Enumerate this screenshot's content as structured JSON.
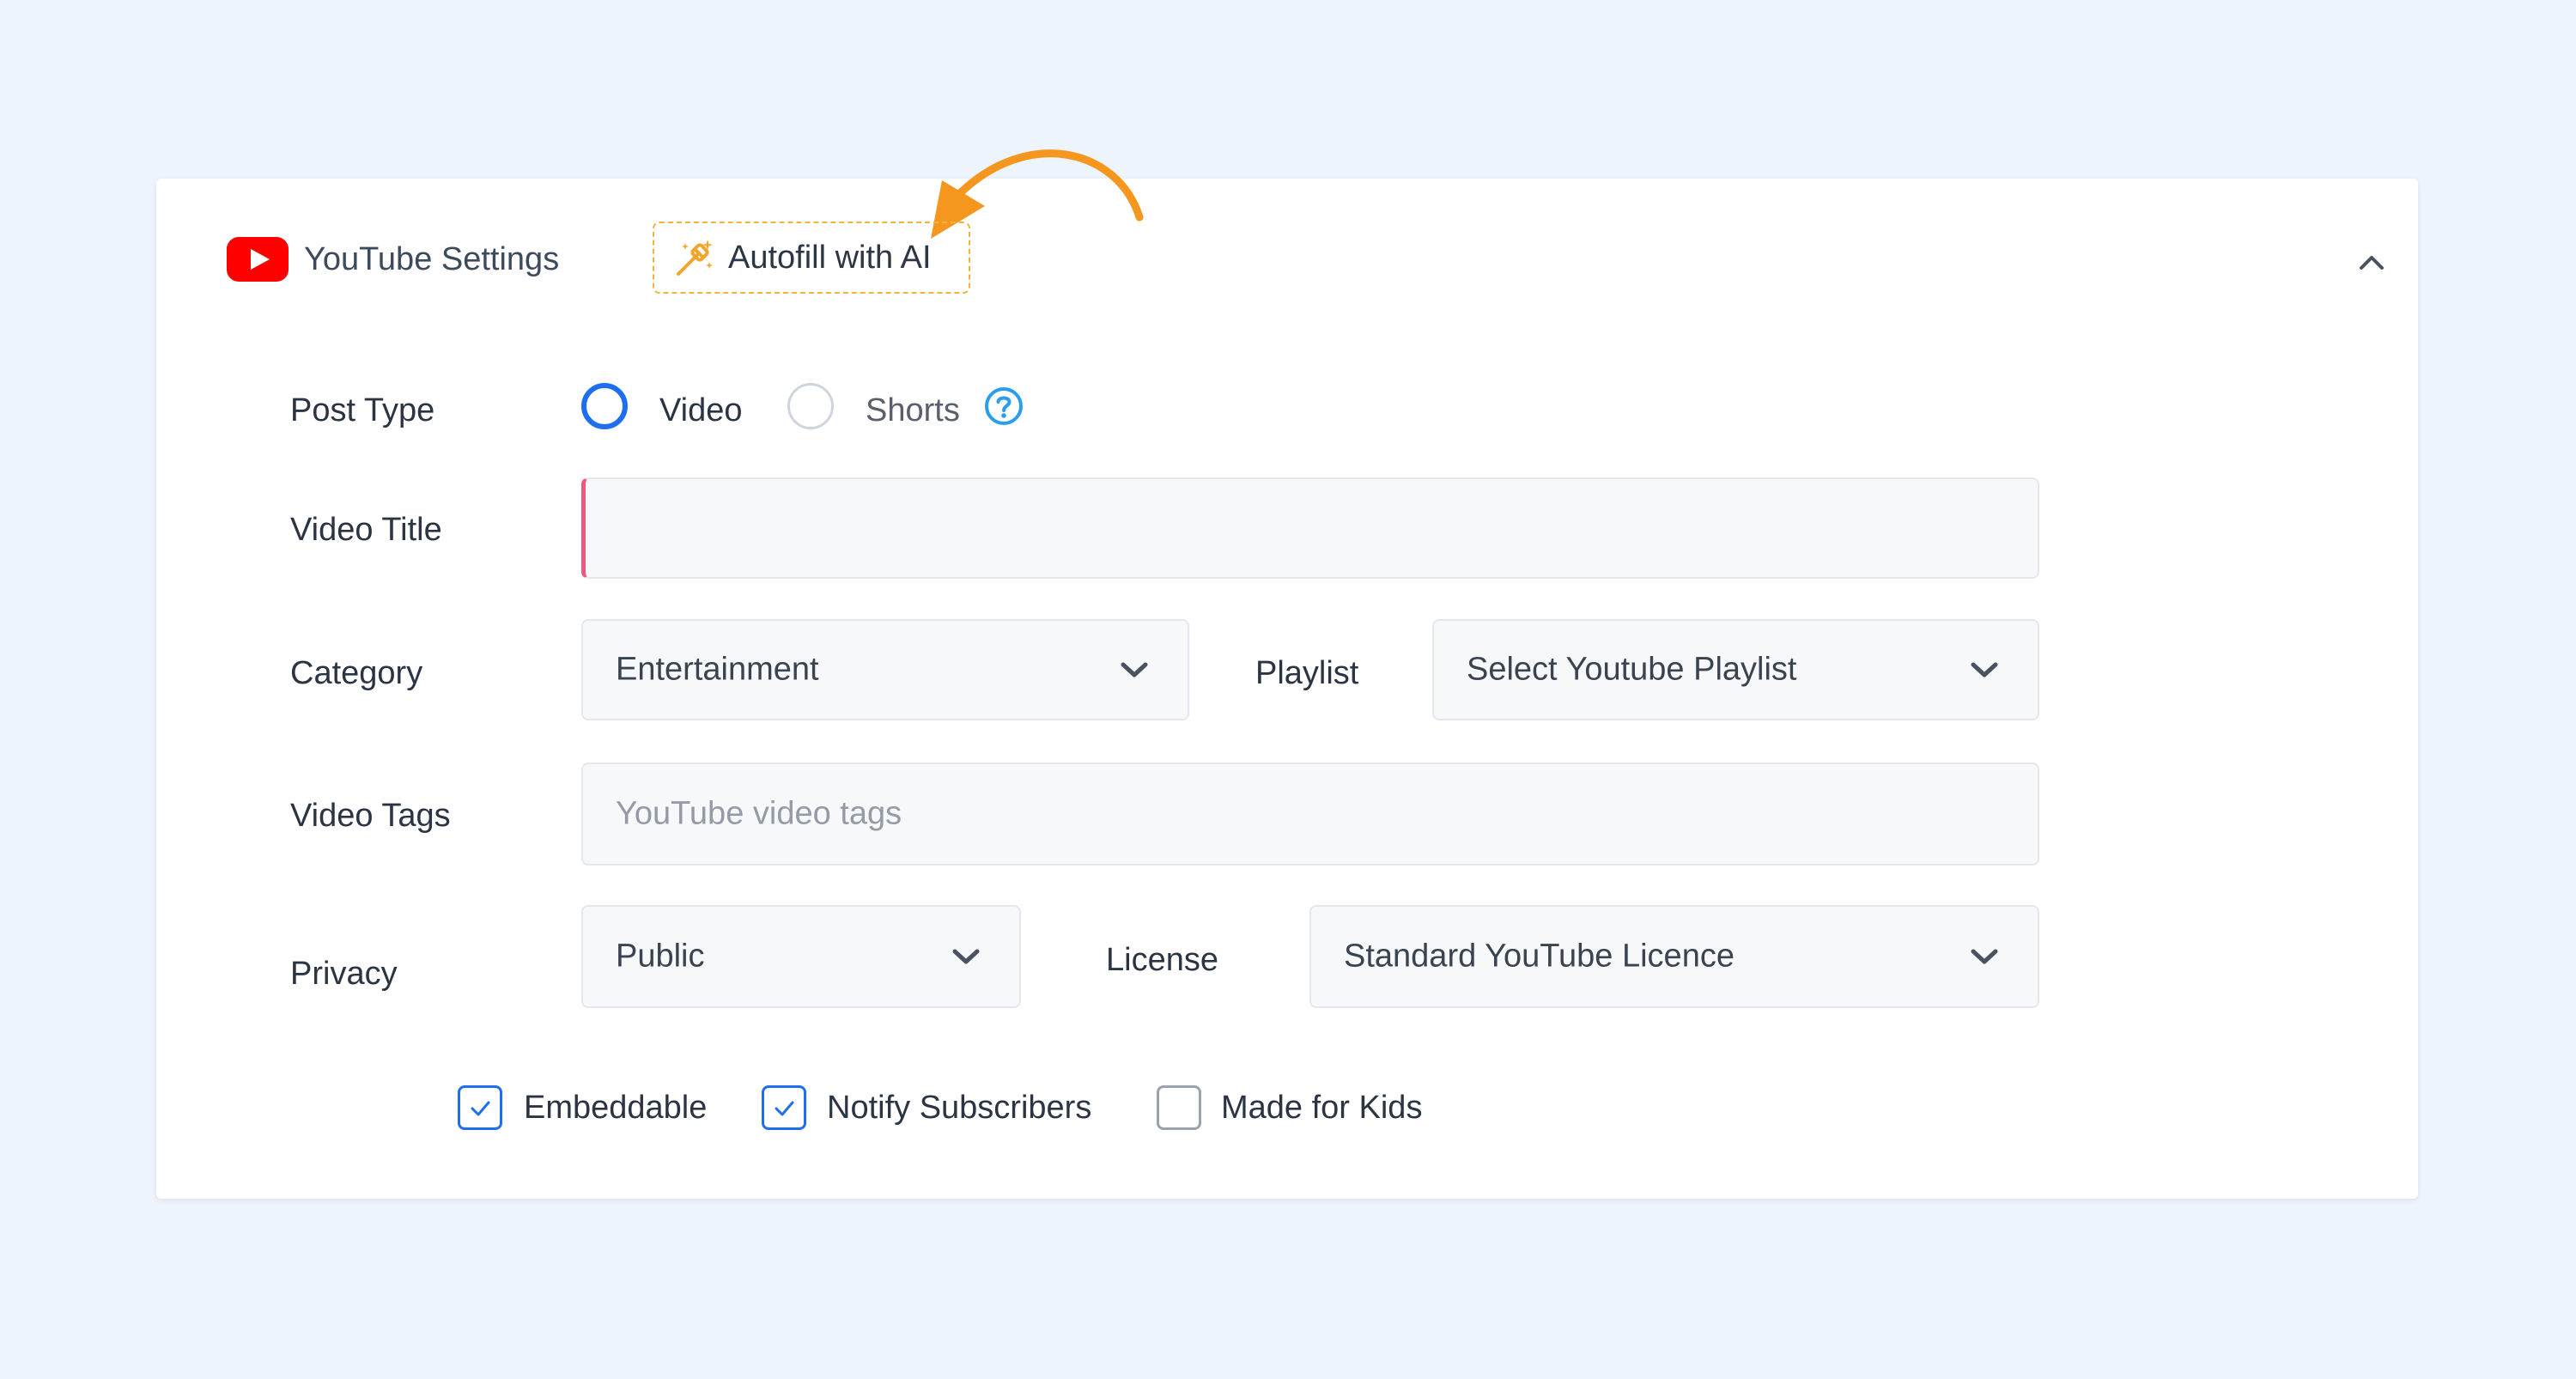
{
  "header": {
    "title": "YouTube Settings",
    "autofill_label": "Autofill with AI"
  },
  "post_type": {
    "label": "Post Type",
    "options": [
      {
        "label": "Video",
        "selected": true
      },
      {
        "label": "Shorts",
        "selected": false
      }
    ]
  },
  "video_title": {
    "label": "Video Title",
    "value": ""
  },
  "category": {
    "label": "Category",
    "value": "Entertainment"
  },
  "playlist": {
    "label": "Playlist",
    "placeholder": "Select Youtube Playlist"
  },
  "video_tags": {
    "label": "Video Tags",
    "placeholder": "YouTube video tags"
  },
  "privacy": {
    "label": "Privacy",
    "value": "Public"
  },
  "license": {
    "label": "License",
    "value": "Standard YouTube Licence"
  },
  "options": {
    "embeddable": {
      "label": "Embeddable",
      "checked": true
    },
    "notify": {
      "label": "Notify Subscribers",
      "checked": true
    },
    "kids": {
      "label": "Made for Kids",
      "checked": false
    }
  },
  "colors": {
    "accent": "#1e6ff0",
    "required": "#f0577d",
    "autofill": "#f2b43a",
    "callout_arrow": "#f5961f",
    "youtube": "#ff0000"
  },
  "icons": {
    "logo": "youtube-logo-icon",
    "autofill": "magic-wand-icon",
    "collapse": "chevron-up-icon",
    "help": "question-circle-icon",
    "select": "chevron-down-icon",
    "check": "checkmark-icon"
  }
}
